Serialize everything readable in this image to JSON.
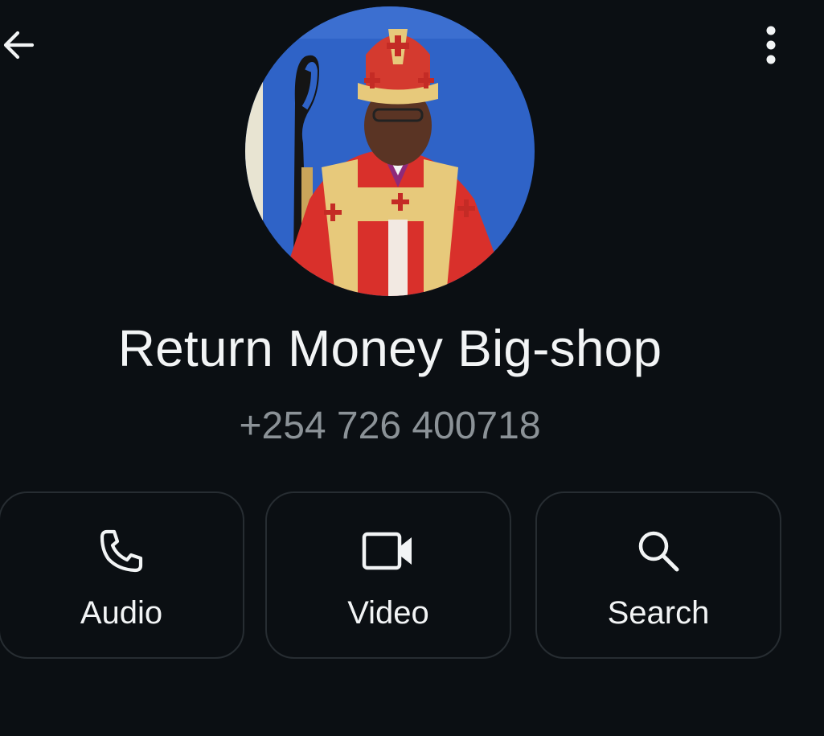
{
  "header": {
    "back_icon": "arrow-left-icon",
    "menu_icon": "more-vertical-icon"
  },
  "contact": {
    "name": "Return Money Big-shop",
    "phone": "+254 726 400718",
    "avatar": "profile-photo"
  },
  "actions": [
    {
      "label": "Audio",
      "icon": "phone-icon"
    },
    {
      "label": "Video",
      "icon": "video-camera-icon"
    },
    {
      "label": "Search",
      "icon": "search-icon"
    }
  ],
  "colors": {
    "background": "#0b0f13",
    "text_primary": "#f2f4f5",
    "text_secondary": "#8b9297",
    "button_border": "#272d32"
  }
}
